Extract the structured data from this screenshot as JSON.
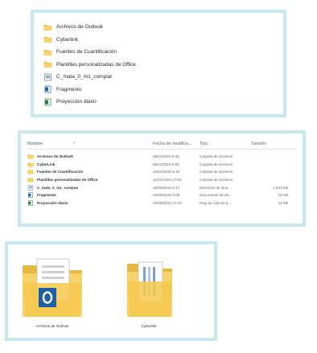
{
  "list_view": {
    "items": [
      {
        "label": "Archivos de Outlook",
        "icon": "folder-icon"
      },
      {
        "label": "Cyberlink",
        "icon": "folder-icon"
      },
      {
        "label": "Fuentes de Cuantificación",
        "icon": "folder-icon"
      },
      {
        "label": "Plantillas personalizadas de Office",
        "icon": "folder-icon"
      },
      {
        "label": "C_mata_0_m1_compiar",
        "icon": "shortcut-icon"
      },
      {
        "label": "Fragmento",
        "icon": "document-icon"
      },
      {
        "label": "Proyección diario",
        "icon": "spreadsheet-icon"
      }
    ]
  },
  "details_view": {
    "columns": {
      "name": "Nombre",
      "date": "Fecha de modifica...",
      "type": "Tipo",
      "size": "Tamaño"
    },
    "sort_indicator": "^",
    "rows": [
      {
        "name": "Archivos de Outlook",
        "date": "08/11/2015 9:15",
        "type": "Carpeta de archivos",
        "size": "",
        "icon": "folder-icon"
      },
      {
        "name": "CyberLink",
        "date": "08/11/2015 9:52",
        "type": "Carpeta de archivos",
        "size": "",
        "icon": "folder-icon"
      },
      {
        "name": "Fuentes de Cuantificación",
        "date": "10/02/2015 9:16",
        "type": "Carpeta de archivos",
        "size": "",
        "icon": "folder-icon"
      },
      {
        "name": "Plantillas personalizadas de Office",
        "date": "12/11/2015 17:53",
        "type": "Carpeta de archivos",
        "size": "",
        "icon": "folder-icon"
      },
      {
        "name": "C_mata_0_m1_compiar",
        "date": "18/09/2015 9:17",
        "type": "Elemento de Bus...",
        "size": "1.824 KB",
        "icon": "shortcut-icon"
      },
      {
        "name": "Fragmento",
        "date": "20/09/2015 9:08",
        "type": "Documento de Mi...",
        "size": "15 KB",
        "icon": "document-icon"
      },
      {
        "name": "Proyección diario",
        "date": "20/09/2015 17:23",
        "type": "Hoja de cálculo d...",
        "size": "11 KB",
        "icon": "spreadsheet-icon"
      }
    ]
  },
  "icons_view": {
    "items": [
      {
        "label": "Archivos de Outlook",
        "icon": "outlook-folder-icon"
      },
      {
        "label": "Cyberlink",
        "icon": "documents-folder-icon"
      }
    ]
  },
  "colors": {
    "panel_border": "#c9e7ef",
    "folder_yellow": "#f8d26a",
    "folder_dark": "#e8b742",
    "outlook_blue": "#1f5fa8",
    "header_text": "#3b5d86"
  }
}
